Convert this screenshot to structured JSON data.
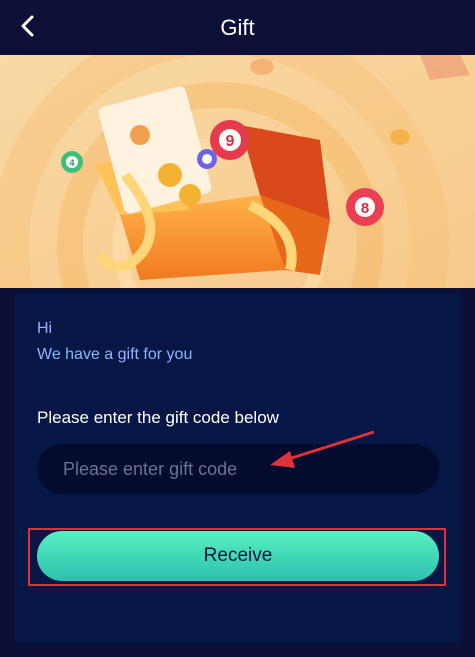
{
  "header": {
    "title": "Gift",
    "back_icon": "chevron-left-icon"
  },
  "gift_card": {
    "greeting": "Hi",
    "message": "We have a gift for you",
    "prompt": "Please enter the gift code below",
    "code_input": {
      "value": "",
      "placeholder": "Please enter gift code"
    },
    "receive_label": "Receive"
  },
  "banner": {
    "lottery_balls": [
      "9",
      "8",
      "4"
    ]
  },
  "colors": {
    "background": "#0b0f36",
    "card": "#061745",
    "accent_teal": "#3fd6b7",
    "highlight_red": "#e0303a"
  }
}
